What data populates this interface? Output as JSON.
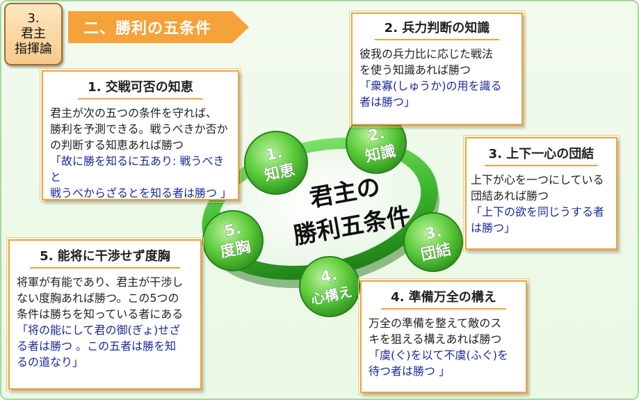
{
  "chapter": {
    "line1": "3.",
    "line2": "君主",
    "line3": "指揮論"
  },
  "banner": {
    "title": "二、勝利の五条件"
  },
  "center": {
    "line1": "君主の",
    "line2": "勝利五条件"
  },
  "circles": [
    {
      "num": "1.",
      "label": "知恵"
    },
    {
      "num": "2.",
      "label": "知識"
    },
    {
      "num": "3.",
      "label": "団結"
    },
    {
      "num": "4.",
      "label": "心構え"
    },
    {
      "num": "5.",
      "label": "度胸"
    }
  ],
  "boxes": {
    "b1": {
      "title": "1. 交戦可否の知恵",
      "lines": [
        "君主が次の五つの条件を守れば、",
        "勝利を予測できる。戦うべきか否か",
        "の判断する知恵あれば勝つ"
      ],
      "quote": [
        "「故に勝を知るに五あり: 戦うべきと",
        "戦うべからざるとを知る者は勝つ 」"
      ]
    },
    "b2": {
      "title": "2. 兵力判断の知識",
      "lines": [
        "彼我の兵力比に応じた戦法",
        "を使う知識あれば勝つ"
      ],
      "quote": [
        "「衆寡(しゅうか)の用を識る",
        "者は勝つ」"
      ]
    },
    "b3": {
      "title": "3. 上下一心の団結",
      "lines": [
        "上下が心を一つにしている",
        "団結あれば勝つ"
      ],
      "quote": [
        "「上下の欲を同じうする者",
        "は勝つ」"
      ]
    },
    "b4": {
      "title": "4. 準備万全の構え",
      "lines": [
        "万全の準備を整えて敵のス",
        "キを狙える構えあれば勝つ"
      ],
      "quote": [
        "「虞(ぐ)を以て不虞(ふぐ)を",
        "待つ者は勝つ 」"
      ]
    },
    "b5": {
      "title": "5. 能将に干渉せず度胸",
      "lines": [
        "将軍が有能であり、君主が干渉し",
        "ない度胸あれば勝つ。この5つの",
        "条件は勝ちを知っている者にある"
      ],
      "quote": [
        "「将の能にして君の御(ぎょ)せざ",
        "る者は勝つ 。この五者は勝を知",
        "るの道なり」"
      ]
    }
  }
}
